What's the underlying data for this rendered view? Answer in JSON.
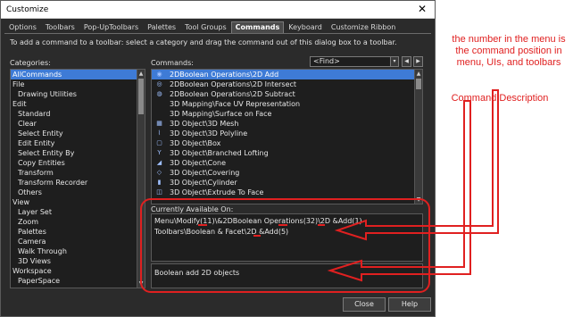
{
  "window": {
    "title": "Customize",
    "close_glyph": "✕"
  },
  "tabs": [
    {
      "label": "Options",
      "active": false
    },
    {
      "label": "Toolbars",
      "active": false
    },
    {
      "label": "Pop-UpToolbars",
      "active": false
    },
    {
      "label": "Palettes",
      "active": false
    },
    {
      "label": "Tool Groups",
      "active": false
    },
    {
      "label": "Commands",
      "active": true
    },
    {
      "label": "Keyboard",
      "active": false
    },
    {
      "label": "Customize Ribbon",
      "active": false
    }
  ],
  "instructions": "To add a command to a toolbar: select a category and drag the command out of this dialog box to a toolbar.",
  "categories": {
    "label": "Categories:",
    "items": [
      {
        "label": "AllCommands",
        "level": 0,
        "selected": true
      },
      {
        "label": "File",
        "level": 0,
        "selected": false
      },
      {
        "label": "Drawing Utilities",
        "level": 1,
        "selected": false
      },
      {
        "label": "Edit",
        "level": 0,
        "selected": false
      },
      {
        "label": "Standard",
        "level": 1,
        "selected": false
      },
      {
        "label": "Clear",
        "level": 1,
        "selected": false
      },
      {
        "label": "Select Entity",
        "level": 1,
        "selected": false
      },
      {
        "label": "Edit Entity",
        "level": 1,
        "selected": false
      },
      {
        "label": "Select Entity By",
        "level": 1,
        "selected": false
      },
      {
        "label": "Copy Entities",
        "level": 1,
        "selected": false
      },
      {
        "label": "Transform",
        "level": 1,
        "selected": false
      },
      {
        "label": "Transform Recorder",
        "level": 1,
        "selected": false
      },
      {
        "label": "Others",
        "level": 1,
        "selected": false
      },
      {
        "label": "View",
        "level": 0,
        "selected": false
      },
      {
        "label": "Layer Set",
        "level": 1,
        "selected": false
      },
      {
        "label": "Zoom",
        "level": 1,
        "selected": false
      },
      {
        "label": "Palettes",
        "level": 1,
        "selected": false
      },
      {
        "label": "Camera",
        "level": 1,
        "selected": false
      },
      {
        "label": "Walk Through",
        "level": 1,
        "selected": false
      },
      {
        "label": "3D Views",
        "level": 1,
        "selected": false
      },
      {
        "label": "Workspace",
        "level": 0,
        "selected": false
      },
      {
        "label": "PaperSpace",
        "level": 1,
        "selected": false
      }
    ]
  },
  "commands": {
    "label": "Commands:",
    "find_value": "<Find>",
    "find_dropdown_glyph": "▾",
    "prev_glyph": "◀",
    "next_glyph": "▶",
    "items": [
      {
        "label": "2DBoolean Operations\\2D Add",
        "icon": "boolean-add-icon",
        "glyph": "◉",
        "selected": true
      },
      {
        "label": "2DBoolean Operations\\2D Intersect",
        "icon": "boolean-intersect-icon",
        "glyph": "◎",
        "selected": false
      },
      {
        "label": "2DBoolean Operations\\2D Subtract",
        "icon": "boolean-subtract-icon",
        "glyph": "◍",
        "selected": false
      },
      {
        "label": "3D Mapping\\Face UV Representation",
        "icon": "face-uv-icon",
        "glyph": "",
        "selected": false
      },
      {
        "label": "3D Mapping\\Surface on Face",
        "icon": "surface-on-face-icon",
        "glyph": "",
        "selected": false
      },
      {
        "label": "3D Object\\3D Mesh",
        "icon": "mesh-icon",
        "glyph": "▦",
        "selected": false
      },
      {
        "label": "3D Object\\3D Polyline",
        "icon": "polyline-icon",
        "glyph": "⌇",
        "selected": false
      },
      {
        "label": "3D Object\\Box",
        "icon": "box-icon",
        "glyph": "▢",
        "selected": false
      },
      {
        "label": "3D Object\\Branched Lofting",
        "icon": "branched-lofting-icon",
        "glyph": "Y",
        "selected": false
      },
      {
        "label": "3D Object\\Cone",
        "icon": "cone-icon",
        "glyph": "◢",
        "selected": false
      },
      {
        "label": "3D Object\\Covering",
        "icon": "covering-icon",
        "glyph": "◇",
        "selected": false
      },
      {
        "label": "3D Object\\Cylinder",
        "icon": "cylinder-icon",
        "glyph": "▮",
        "selected": false
      },
      {
        "label": "3D Object\\Extrude To Face",
        "icon": "extrude-icon",
        "glyph": "◫",
        "selected": false
      }
    ]
  },
  "available": {
    "label": "Currently Available On:",
    "lines": [
      "Menu\\Modify(11)\\&2DBoolean Operations(32)\\2D &Add(1)",
      "Toolbars\\Boolean & Facet\\2D &Add(5)"
    ]
  },
  "description": {
    "text": "Boolean add 2D objects"
  },
  "buttons": {
    "close": "Close",
    "help": "Help"
  },
  "annotations": {
    "position_note": "the number in the menu is the command position in menu, UIs, and toolbars",
    "description_note": "Command Description",
    "color": "#e02020"
  }
}
